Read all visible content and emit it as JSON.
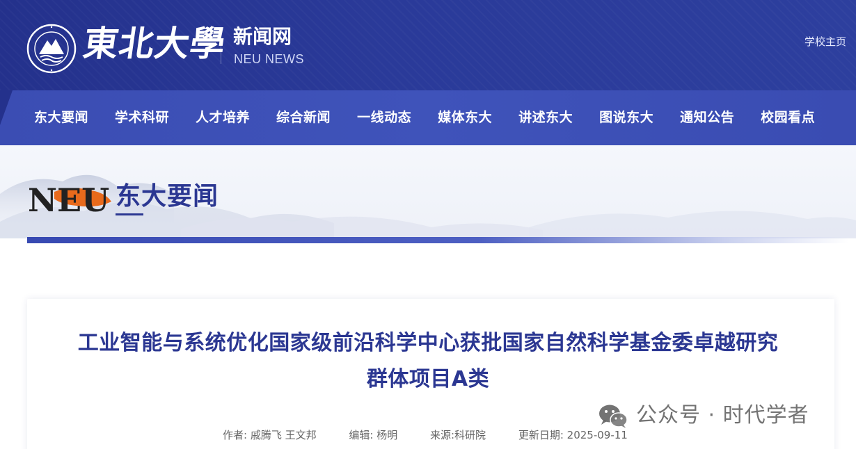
{
  "header": {
    "calligraphy": "東北大學",
    "site_name": "新闻网",
    "site_sub": "NEU NEWS",
    "home_link": "学校主页"
  },
  "nav": {
    "items": [
      {
        "label": "东大要闻"
      },
      {
        "label": "学术科研"
      },
      {
        "label": "人才培养"
      },
      {
        "label": "综合新闻"
      },
      {
        "label": "一线动态"
      },
      {
        "label": "媒体东大"
      },
      {
        "label": "讲述东大"
      },
      {
        "label": "图说东大"
      },
      {
        "label": "通知公告"
      },
      {
        "label": "校园看点"
      }
    ]
  },
  "banner": {
    "logo_text": "NEU",
    "section_title": "东大要闻"
  },
  "article": {
    "title_line1": "工业智能与系统优化国家级前沿科学中心获批国家自然科学基金委卓越研究",
    "title_line2": "群体项目A类",
    "author": "作者: 戚腾飞 王文邦",
    "editor": "编辑: 杨明",
    "source": "来源:科研院",
    "updated": "更新日期: 2025-09-11"
  },
  "watermark": {
    "text": "公众号 · 时代学者",
    "icon": "wechat-icon"
  },
  "colors": {
    "header_bg": "#24318c",
    "nav_bg": "#3f53ba",
    "title_blue": "#2b3792",
    "accent_orange": "#e86a1c"
  }
}
